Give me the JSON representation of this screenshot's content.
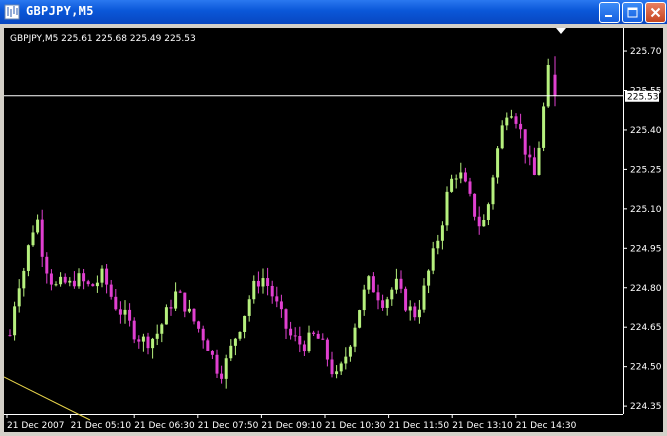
{
  "window": {
    "title": "GBPJPY,M5",
    "icons": {
      "app": "chart-window-icon",
      "minimize": "minimize-icon",
      "maximize": "maximize-icon",
      "close": "close-icon"
    }
  },
  "chart": {
    "header": "GBPJPY,M5  225.61 225.68 225.49 225.53",
    "current_price_label": "225.53",
    "current_price": 225.53,
    "colors": {
      "background": "#000000",
      "bull": "#b6f07e",
      "bear": "#e040d0",
      "axis": "#ffffff",
      "price_line": "#ffffff",
      "overlay_line": "#e8d44a"
    }
  },
  "chart_data": {
    "type": "candlestick",
    "ylim": [
      224.32,
      225.78
    ],
    "y_ticks": [
      225.7,
      225.55,
      225.4,
      225.25,
      225.1,
      224.95,
      224.8,
      224.65,
      224.5,
      224.35
    ],
    "y_tick_labels": [
      "225.70",
      "225.55",
      "225.40",
      "225.25",
      "225.10",
      "224.95",
      "224.80",
      "224.65",
      "224.50",
      "224.35"
    ],
    "x_tick_labels": [
      "21 Dec 2007",
      "21 Dec 05:10",
      "21 Dec 06:30",
      "21 Dec 07:50",
      "21 Dec 09:10",
      "21 Dec 10:30",
      "21 Dec 11:50",
      "21 Dec 13:10",
      "21 Dec 14:30"
    ],
    "trend": [
      224.62,
      224.8,
      224.86,
      224.98,
      225.08,
      224.92,
      224.84,
      224.8,
      224.82,
      224.81,
      224.84,
      224.82,
      224.8,
      224.82,
      224.85,
      224.78,
      224.73,
      224.7,
      224.66,
      224.62,
      224.6,
      224.6,
      224.62,
      224.67,
      224.73,
      224.78,
      224.75,
      224.7,
      224.66,
      224.62,
      224.57,
      224.5,
      224.48,
      224.55,
      224.62,
      224.68,
      224.76,
      224.82,
      224.84,
      224.8,
      224.74,
      224.68,
      224.62,
      224.6,
      224.58,
      224.6,
      224.62,
      224.58,
      224.52,
      224.45,
      224.5,
      224.58,
      224.67,
      224.76,
      224.82,
      224.79,
      224.75,
      224.77,
      224.82,
      224.76,
      224.72,
      224.7,
      224.76,
      224.86,
      224.95,
      225.05,
      225.18,
      225.24,
      225.22,
      225.15,
      225.08,
      225.02,
      225.12,
      225.28,
      225.4,
      225.5,
      225.46,
      225.38,
      225.28,
      225.22,
      225.42,
      225.62
    ],
    "last_candle": {
      "open": 225.61,
      "high": 225.68,
      "low": 225.49,
      "close": 225.53
    }
  }
}
